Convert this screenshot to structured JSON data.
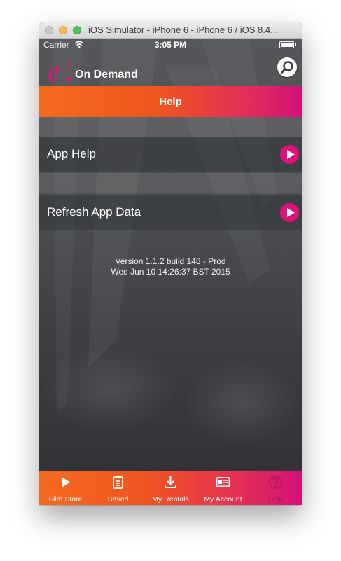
{
  "window": {
    "title": "iOS Simulator - iPhone 6 - iPhone 6 / iOS 8.4..."
  },
  "status_bar": {
    "carrier": "Carrier",
    "time": "3:05 PM"
  },
  "nav_bar": {
    "logo_letter": "e",
    "logo_small": "vision",
    "logo_text": "On Demand"
  },
  "header": {
    "title": "Help"
  },
  "menu": {
    "items": [
      {
        "label": "App Help"
      },
      {
        "label": "Refresh App Data"
      }
    ]
  },
  "version": {
    "line1": "Version 1.1.2 build 148 - Prod",
    "line2": "Wed Jun 10 14:26:37 BST 2015"
  },
  "tab_bar": {
    "tabs": [
      {
        "label": "Film Store",
        "icon": "play-icon"
      },
      {
        "label": "Saved",
        "icon": "clipboard-icon"
      },
      {
        "label": "My Rentals",
        "icon": "download-icon"
      },
      {
        "label": "My Account",
        "icon": "id-card-icon"
      },
      {
        "label": "Help",
        "icon": "question-icon"
      }
    ],
    "active": "Help"
  },
  "colors": {
    "accent_orange": "#f26a1f",
    "accent_magenta": "#d4117a",
    "background": "#45474a"
  }
}
